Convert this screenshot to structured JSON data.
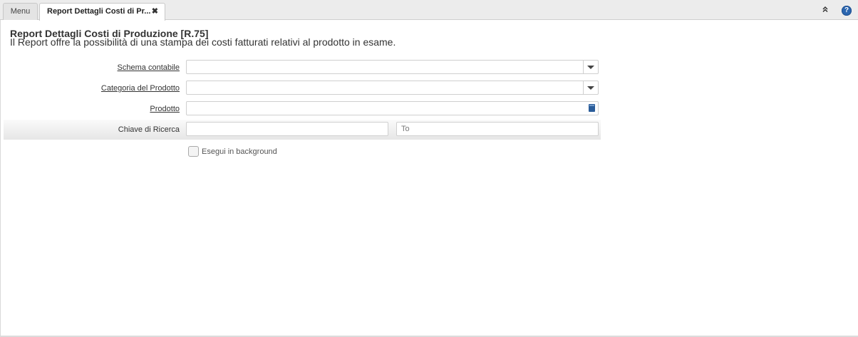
{
  "tabs": {
    "menu_label": "Menu",
    "active_label": "Report Dettagli Costi di Pr...",
    "close_glyph": "✖",
    "collapse_glyph": "»",
    "help_glyph": "?"
  },
  "report": {
    "title": "Report Dettagli Costi di Produzione [R.75]",
    "description": "Il Report offre la possibilità di una stampa dei costi fatturati relativi al prodotto in esame."
  },
  "form": {
    "schema_label": "Schema contabile",
    "schema_value": "",
    "categoria_label": "Categoria del Prodotto",
    "categoria_value": "",
    "prodotto_label": "Prodotto",
    "prodotto_value": "",
    "chiave_label": "Chiave di Ricerca",
    "chiave_from_value": "",
    "chiave_to_placeholder": "To",
    "background_label": "Esegui in background",
    "background_checked": false
  },
  "icons": {
    "dropdown": "chevron-down-icon",
    "lookup": "book-icon",
    "help": "help-icon",
    "collapse": "collapse-up-icon",
    "close": "close-icon"
  },
  "colors": {
    "help_blue": "#2b66b0",
    "lookup_blue": "#2b5d9a"
  }
}
